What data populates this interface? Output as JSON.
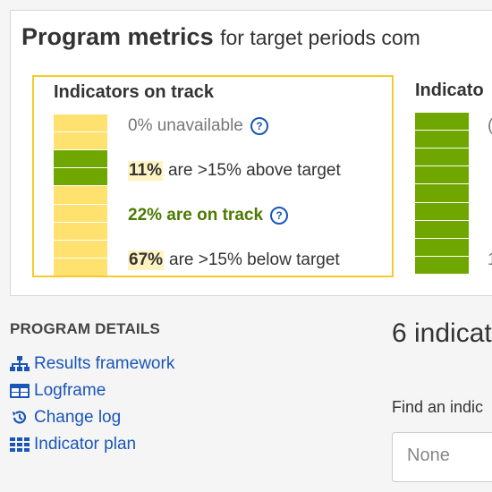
{
  "metrics": {
    "title": "Program metrics",
    "subtitle": "for target periods com",
    "card1": {
      "title": "Indicators on track",
      "segments": [
        "yellow",
        "yellow",
        "green",
        "green",
        "yellow",
        "yellow",
        "yellow",
        "yellow",
        "yellow"
      ],
      "colors": {
        "yellow": "#ffe170",
        "green": "#6fa700"
      },
      "rows": {
        "unavailable": {
          "text": "0% unavailable"
        },
        "above": {
          "pct": "11%",
          "text": "are >15% above target"
        },
        "on_track": {
          "text": "22% are on track"
        },
        "below": {
          "pct": "67%",
          "text": "are >15% below target"
        }
      },
      "values": {
        "unavailable": 0,
        "above": 11,
        "on_track": 22,
        "below": 67
      }
    },
    "card2": {
      "title": "Indicato",
      "peek_top": "(",
      "peek_bottom": "1"
    }
  },
  "program_details": {
    "heading": "PROGRAM DETAILS",
    "links": [
      {
        "label": "Results framework",
        "icon": "sitemap-icon"
      },
      {
        "label": "Logframe",
        "icon": "table-icon"
      },
      {
        "label": "Change log",
        "icon": "history-icon"
      },
      {
        "label": "Indicator plan",
        "icon": "grid-icon"
      }
    ]
  },
  "indicators": {
    "count_text": "6 indicat",
    "find_label": "Find an indic",
    "find_value": "None"
  }
}
